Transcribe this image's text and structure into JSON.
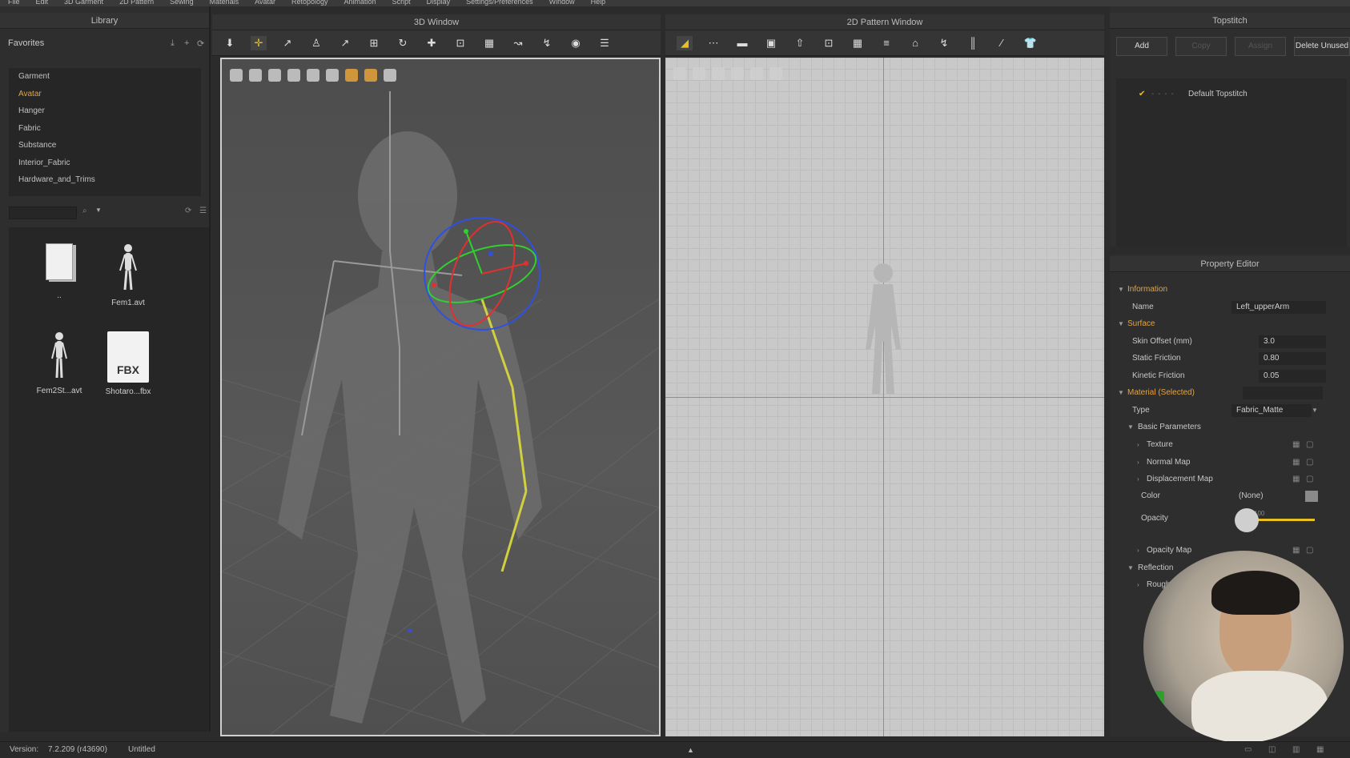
{
  "menu": [
    "File",
    "Edit",
    "3D Garment",
    "2D Pattern",
    "Sewing",
    "Materials",
    "Avatar",
    "Retopology",
    "Animation",
    "Script",
    "Display",
    "Settings/Preferences",
    "Window",
    "Help"
  ],
  "library": {
    "title": "Library",
    "favorites_label": "Favorites",
    "items": [
      "Garment",
      "Avatar",
      "Hanger",
      "Fabric",
      "Substance",
      "Interior_Fabric",
      "Hardware_and_Trims"
    ],
    "active_item": "Avatar",
    "thumbs": [
      {
        "label": "..",
        "icon": "folder-icon"
      },
      {
        "label": "Fem1.avt",
        "icon": "avatar-icon"
      },
      {
        "label": "Fem2St...avt",
        "icon": "avatar-icon"
      },
      {
        "label": "Shotaro...fbx",
        "icon": "fbx-file-icon",
        "badge": "FBX"
      }
    ]
  },
  "window3d": {
    "title": "3D Window"
  },
  "window2d": {
    "title": "2D Pattern Window"
  },
  "topstitch": {
    "title": "Topstitch",
    "buttons": {
      "add": "Add",
      "copy": "Copy",
      "assign": "Assign",
      "delete_unused": "Delete Unused"
    },
    "items": [
      "Default Topstitch"
    ]
  },
  "property": {
    "title": "Property Editor",
    "information": "Information",
    "name_label": "Name",
    "name_value": "Left_upperArm",
    "surface": "Surface",
    "skin_offset_label": "Skin Offset (mm)",
    "skin_offset_value": "3.0",
    "static_friction_label": "Static Friction",
    "static_friction_value": "0.80",
    "kinetic_friction_label": "Kinetic Friction",
    "kinetic_friction_value": "0.05",
    "material": "Material (Selected)",
    "type_label": "Type",
    "type_value": "Fabric_Matte",
    "basic_params": "Basic Parameters",
    "texture": "Texture",
    "normal_map": "Normal Map",
    "displacement_map": "Displacement Map",
    "color_label": "Color",
    "color_value": "(None)",
    "opacity_label": "Opacity",
    "opacity_value": "100",
    "opacity_map": "Opacity Map",
    "reflection": "Reflection",
    "roughness": "Rough"
  },
  "status": {
    "version_label": "Version:",
    "version_value": "7.2.209 (r43690)",
    "file": "Untitled"
  },
  "colors": {
    "accent": "#e8a33a"
  }
}
